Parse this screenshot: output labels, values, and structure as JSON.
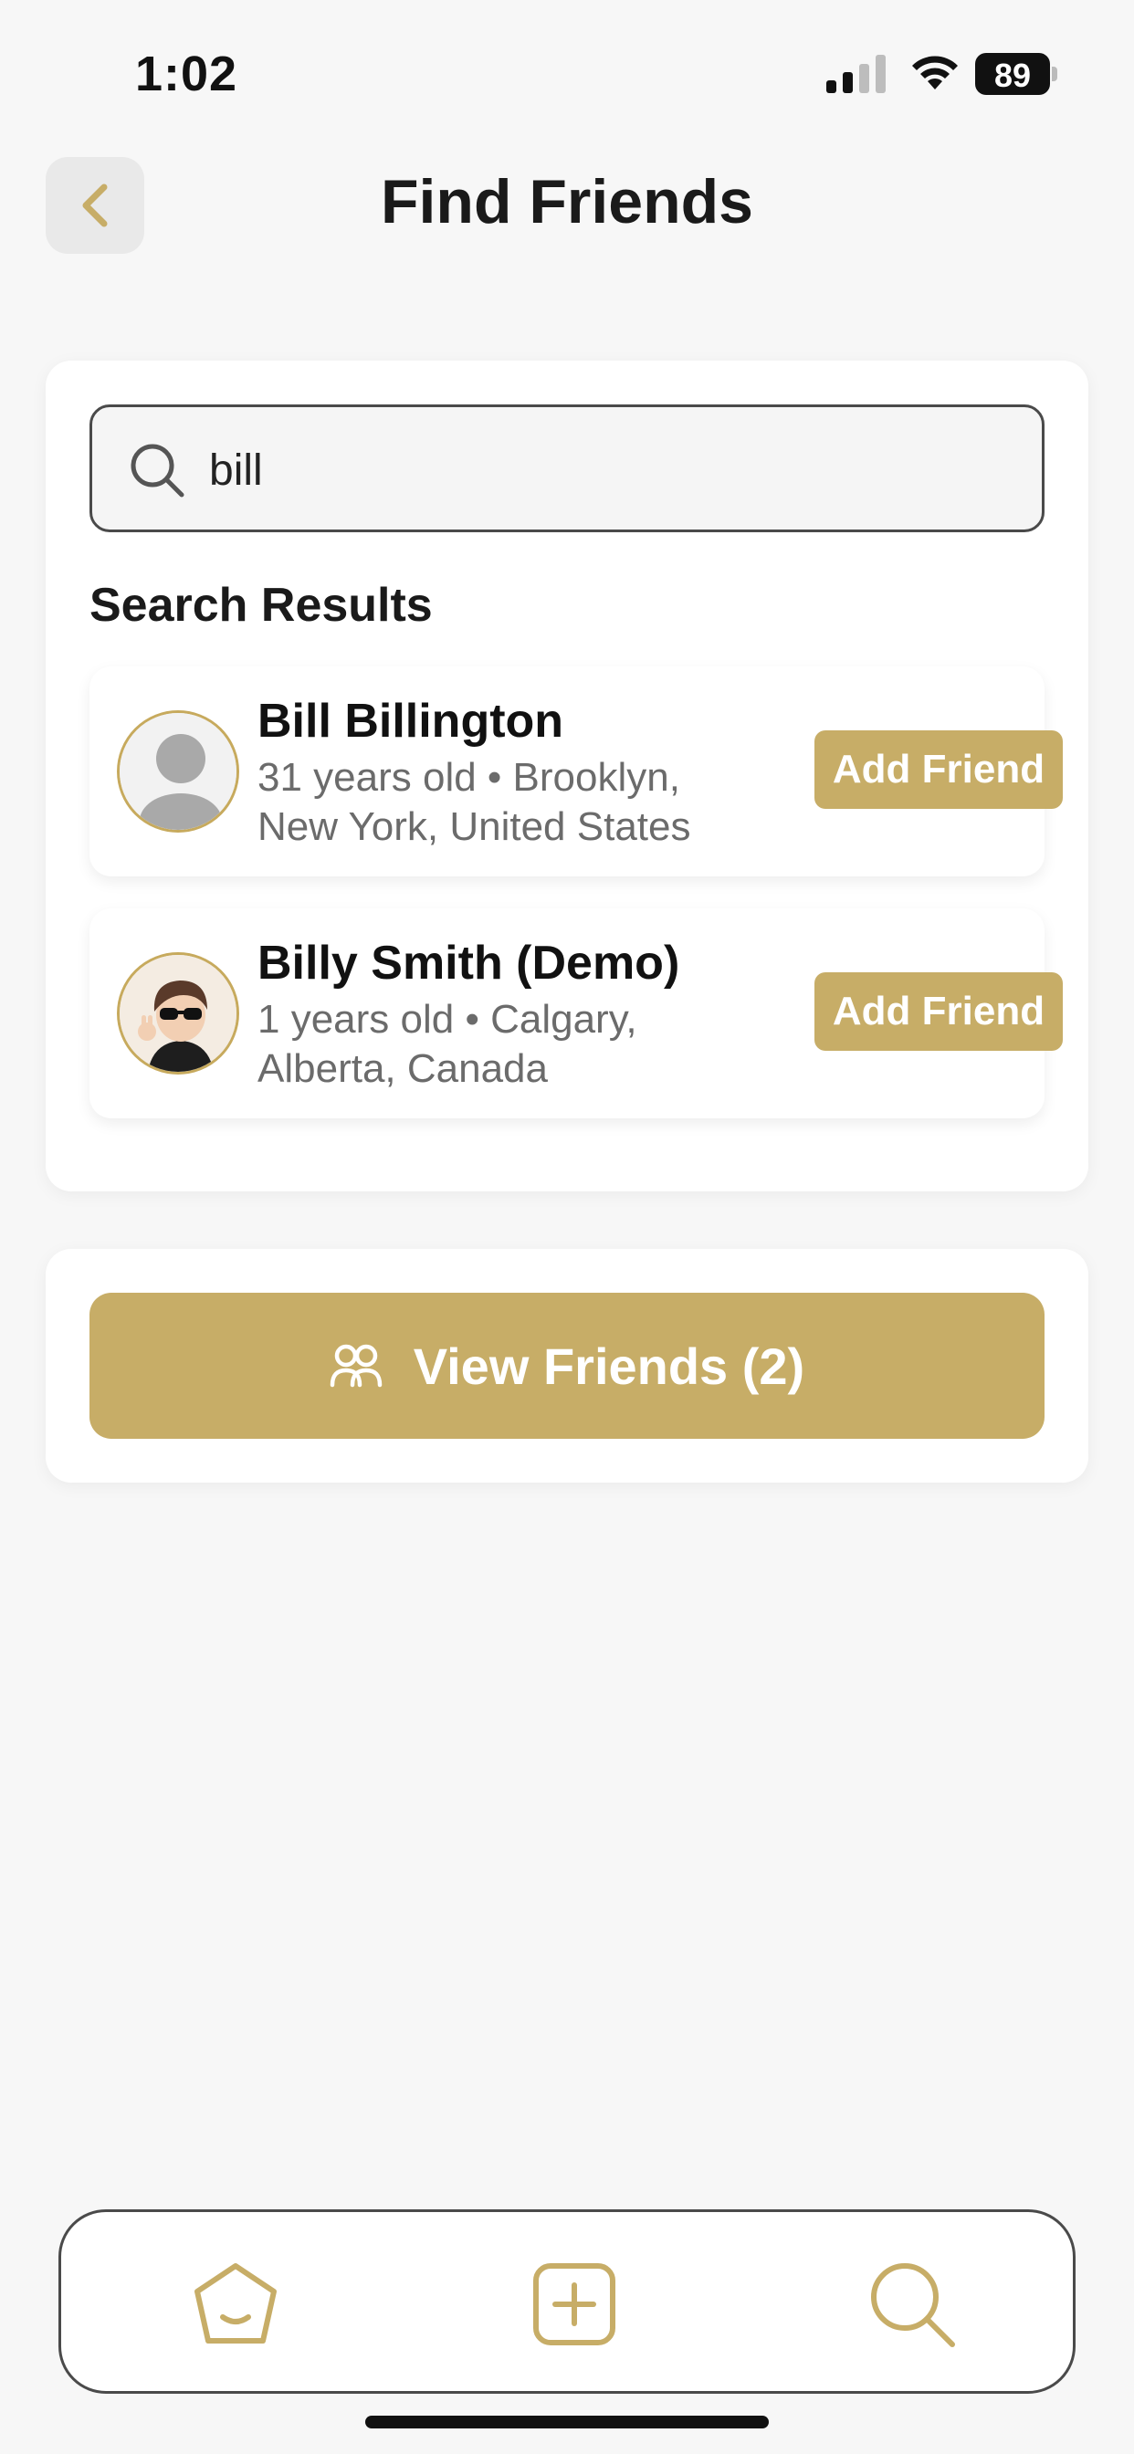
{
  "status_bar": {
    "time": "1:02",
    "battery": "89"
  },
  "header": {
    "title": "Find Friends",
    "back_icon": "chevron-left-icon"
  },
  "search": {
    "value": "bill",
    "icon": "search-icon"
  },
  "results": {
    "heading": "Search Results",
    "items": [
      {
        "name": "Bill Billington",
        "details": "31 years old • Brooklyn, New York, United States",
        "button_label": "Add Friend",
        "avatar": "default-avatar-icon"
      },
      {
        "name": "Billy Smith (Demo)",
        "details": "1 years old • Calgary, Alberta, Canada",
        "button_label": "Add Friend",
        "avatar": "cartoon-avatar"
      }
    ]
  },
  "friends_button": {
    "label": "View Friends (2)",
    "icon": "people-icon"
  },
  "tab_bar": {
    "items": [
      {
        "icon": "home-icon"
      },
      {
        "icon": "add-square-icon"
      },
      {
        "icon": "search-icon"
      }
    ]
  },
  "colors": {
    "accent": "#c7ad67",
    "background": "#f7f7f7",
    "card": "#ffffff",
    "text_primary": "#1a1a1a",
    "text_secondary": "#6b6b6b"
  }
}
